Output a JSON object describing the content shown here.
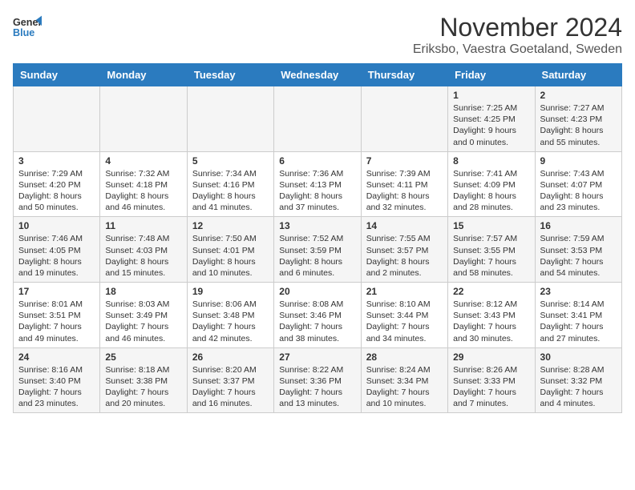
{
  "logo": {
    "line1": "General",
    "line2": "Blue"
  },
  "title": "November 2024",
  "subtitle": "Eriksbo, Vaestra Goetaland, Sweden",
  "weekdays": [
    "Sunday",
    "Monday",
    "Tuesday",
    "Wednesday",
    "Thursday",
    "Friday",
    "Saturday"
  ],
  "weeks": [
    [
      {
        "day": "",
        "info": ""
      },
      {
        "day": "",
        "info": ""
      },
      {
        "day": "",
        "info": ""
      },
      {
        "day": "",
        "info": ""
      },
      {
        "day": "",
        "info": ""
      },
      {
        "day": "1",
        "info": "Sunrise: 7:25 AM\nSunset: 4:25 PM\nDaylight: 9 hours\nand 0 minutes."
      },
      {
        "day": "2",
        "info": "Sunrise: 7:27 AM\nSunset: 4:23 PM\nDaylight: 8 hours\nand 55 minutes."
      }
    ],
    [
      {
        "day": "3",
        "info": "Sunrise: 7:29 AM\nSunset: 4:20 PM\nDaylight: 8 hours\nand 50 minutes."
      },
      {
        "day": "4",
        "info": "Sunrise: 7:32 AM\nSunset: 4:18 PM\nDaylight: 8 hours\nand 46 minutes."
      },
      {
        "day": "5",
        "info": "Sunrise: 7:34 AM\nSunset: 4:16 PM\nDaylight: 8 hours\nand 41 minutes."
      },
      {
        "day": "6",
        "info": "Sunrise: 7:36 AM\nSunset: 4:13 PM\nDaylight: 8 hours\nand 37 minutes."
      },
      {
        "day": "7",
        "info": "Sunrise: 7:39 AM\nSunset: 4:11 PM\nDaylight: 8 hours\nand 32 minutes."
      },
      {
        "day": "8",
        "info": "Sunrise: 7:41 AM\nSunset: 4:09 PM\nDaylight: 8 hours\nand 28 minutes."
      },
      {
        "day": "9",
        "info": "Sunrise: 7:43 AM\nSunset: 4:07 PM\nDaylight: 8 hours\nand 23 minutes."
      }
    ],
    [
      {
        "day": "10",
        "info": "Sunrise: 7:46 AM\nSunset: 4:05 PM\nDaylight: 8 hours\nand 19 minutes."
      },
      {
        "day": "11",
        "info": "Sunrise: 7:48 AM\nSunset: 4:03 PM\nDaylight: 8 hours\nand 15 minutes."
      },
      {
        "day": "12",
        "info": "Sunrise: 7:50 AM\nSunset: 4:01 PM\nDaylight: 8 hours\nand 10 minutes."
      },
      {
        "day": "13",
        "info": "Sunrise: 7:52 AM\nSunset: 3:59 PM\nDaylight: 8 hours\nand 6 minutes."
      },
      {
        "day": "14",
        "info": "Sunrise: 7:55 AM\nSunset: 3:57 PM\nDaylight: 8 hours\nand 2 minutes."
      },
      {
        "day": "15",
        "info": "Sunrise: 7:57 AM\nSunset: 3:55 PM\nDaylight: 7 hours\nand 58 minutes."
      },
      {
        "day": "16",
        "info": "Sunrise: 7:59 AM\nSunset: 3:53 PM\nDaylight: 7 hours\nand 54 minutes."
      }
    ],
    [
      {
        "day": "17",
        "info": "Sunrise: 8:01 AM\nSunset: 3:51 PM\nDaylight: 7 hours\nand 49 minutes."
      },
      {
        "day": "18",
        "info": "Sunrise: 8:03 AM\nSunset: 3:49 PM\nDaylight: 7 hours\nand 46 minutes."
      },
      {
        "day": "19",
        "info": "Sunrise: 8:06 AM\nSunset: 3:48 PM\nDaylight: 7 hours\nand 42 minutes."
      },
      {
        "day": "20",
        "info": "Sunrise: 8:08 AM\nSunset: 3:46 PM\nDaylight: 7 hours\nand 38 minutes."
      },
      {
        "day": "21",
        "info": "Sunrise: 8:10 AM\nSunset: 3:44 PM\nDaylight: 7 hours\nand 34 minutes."
      },
      {
        "day": "22",
        "info": "Sunrise: 8:12 AM\nSunset: 3:43 PM\nDaylight: 7 hours\nand 30 minutes."
      },
      {
        "day": "23",
        "info": "Sunrise: 8:14 AM\nSunset: 3:41 PM\nDaylight: 7 hours\nand 27 minutes."
      }
    ],
    [
      {
        "day": "24",
        "info": "Sunrise: 8:16 AM\nSunset: 3:40 PM\nDaylight: 7 hours\nand 23 minutes."
      },
      {
        "day": "25",
        "info": "Sunrise: 8:18 AM\nSunset: 3:38 PM\nDaylight: 7 hours\nand 20 minutes."
      },
      {
        "day": "26",
        "info": "Sunrise: 8:20 AM\nSunset: 3:37 PM\nDaylight: 7 hours\nand 16 minutes."
      },
      {
        "day": "27",
        "info": "Sunrise: 8:22 AM\nSunset: 3:36 PM\nDaylight: 7 hours\nand 13 minutes."
      },
      {
        "day": "28",
        "info": "Sunrise: 8:24 AM\nSunset: 3:34 PM\nDaylight: 7 hours\nand 10 minutes."
      },
      {
        "day": "29",
        "info": "Sunrise: 8:26 AM\nSunset: 3:33 PM\nDaylight: 7 hours\nand 7 minutes."
      },
      {
        "day": "30",
        "info": "Sunrise: 8:28 AM\nSunset: 3:32 PM\nDaylight: 7 hours\nand 4 minutes."
      }
    ]
  ]
}
